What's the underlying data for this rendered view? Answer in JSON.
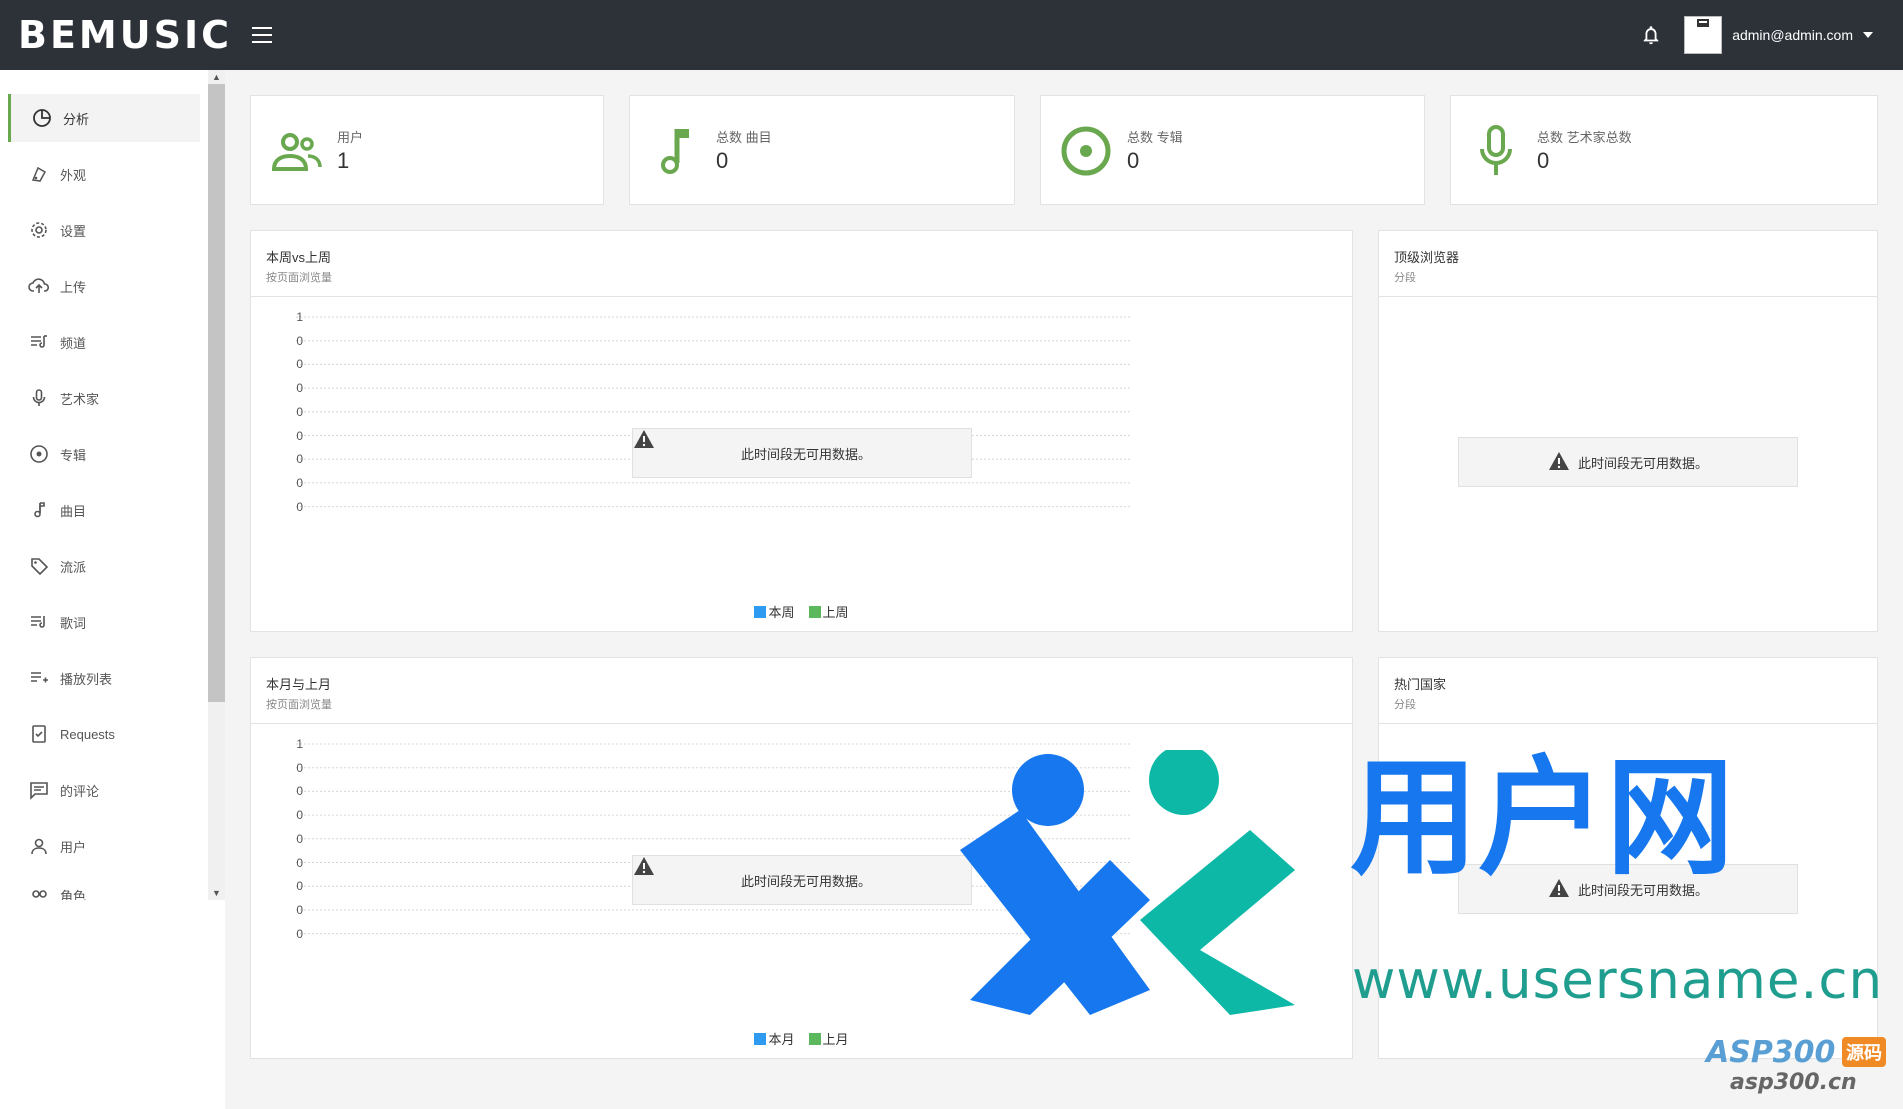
{
  "header": {
    "brand": "BEMUSIC",
    "user_email": "admin@admin.com"
  },
  "sidebar": {
    "items": [
      {
        "label": "分析",
        "icon": "pie-chart-icon"
      },
      {
        "label": "外观",
        "icon": "palette-icon"
      },
      {
        "label": "设置",
        "icon": "gear-icon"
      },
      {
        "label": "上传",
        "icon": "cloud-upload-icon"
      },
      {
        "label": "频道",
        "icon": "queue-music-icon"
      },
      {
        "label": "艺术家",
        "icon": "mic-icon"
      },
      {
        "label": "专辑",
        "icon": "album-icon"
      },
      {
        "label": "曲目",
        "icon": "music-note-icon"
      },
      {
        "label": "流派",
        "icon": "tag-icon"
      },
      {
        "label": "歌词",
        "icon": "lyrics-icon"
      },
      {
        "label": "播放列表",
        "icon": "playlist-icon"
      },
      {
        "label": "Requests",
        "icon": "request-icon"
      },
      {
        "label": "的评论",
        "icon": "comment-icon"
      },
      {
        "label": "用户",
        "icon": "person-icon"
      },
      {
        "label": "角色",
        "icon": "roles-icon"
      }
    ]
  },
  "stats": [
    {
      "label": "用户",
      "value": "1",
      "icon": "people-icon"
    },
    {
      "label": "总数 曲目",
      "value": "0",
      "icon": "music-note-icon"
    },
    {
      "label": "总数 专辑",
      "value": "0",
      "icon": "album-icon"
    },
    {
      "label": "总数 艺术家总数",
      "value": "0",
      "icon": "mic-icon"
    }
  ],
  "panels": {
    "weekly": {
      "title": "本周vs上周",
      "subtitle": "按页面浏览量",
      "no_data": "此时间段无可用数据。",
      "legend": [
        "本周",
        "上周"
      ]
    },
    "browsers": {
      "title": "顶级浏览器",
      "subtitle": "分段",
      "no_data": "此时间段无可用数据。"
    },
    "monthly": {
      "title": "本月与上月",
      "subtitle": "按页面浏览量",
      "no_data": "此时间段无可用数据。",
      "legend": [
        "本月",
        "上月"
      ]
    },
    "countries": {
      "title": "热门国家",
      "subtitle": "分段",
      "no_data": "此时间段无可用数据。"
    }
  },
  "chart_data": [
    {
      "type": "line",
      "ticks": [
        "1",
        "0",
        "0",
        "0",
        "0",
        "0",
        "0",
        "0",
        "0"
      ],
      "series": [
        {
          "name": "本周",
          "color": "#2e9bf0",
          "values": []
        },
        {
          "name": "上周",
          "color": "#5cb85c",
          "values": []
        }
      ]
    },
    {
      "type": "line",
      "ticks": [
        "1",
        "0",
        "0",
        "0",
        "0",
        "0",
        "0",
        "0",
        "0"
      ],
      "series": [
        {
          "name": "本月",
          "color": "#2e9bf0",
          "values": []
        },
        {
          "name": "上月",
          "color": "#5cb85c",
          "values": []
        }
      ]
    }
  ],
  "colors": {
    "accent": "#6aa84f",
    "header_bg": "#2c3238",
    "series_a": "#2e9bf0",
    "series_b": "#5cb85c"
  },
  "watermark": {
    "brand": "用户网",
    "url": "www.usersname.cn",
    "badge": "ASP300",
    "badge_tag": "源码",
    "badge_url": "asp300.cn"
  }
}
